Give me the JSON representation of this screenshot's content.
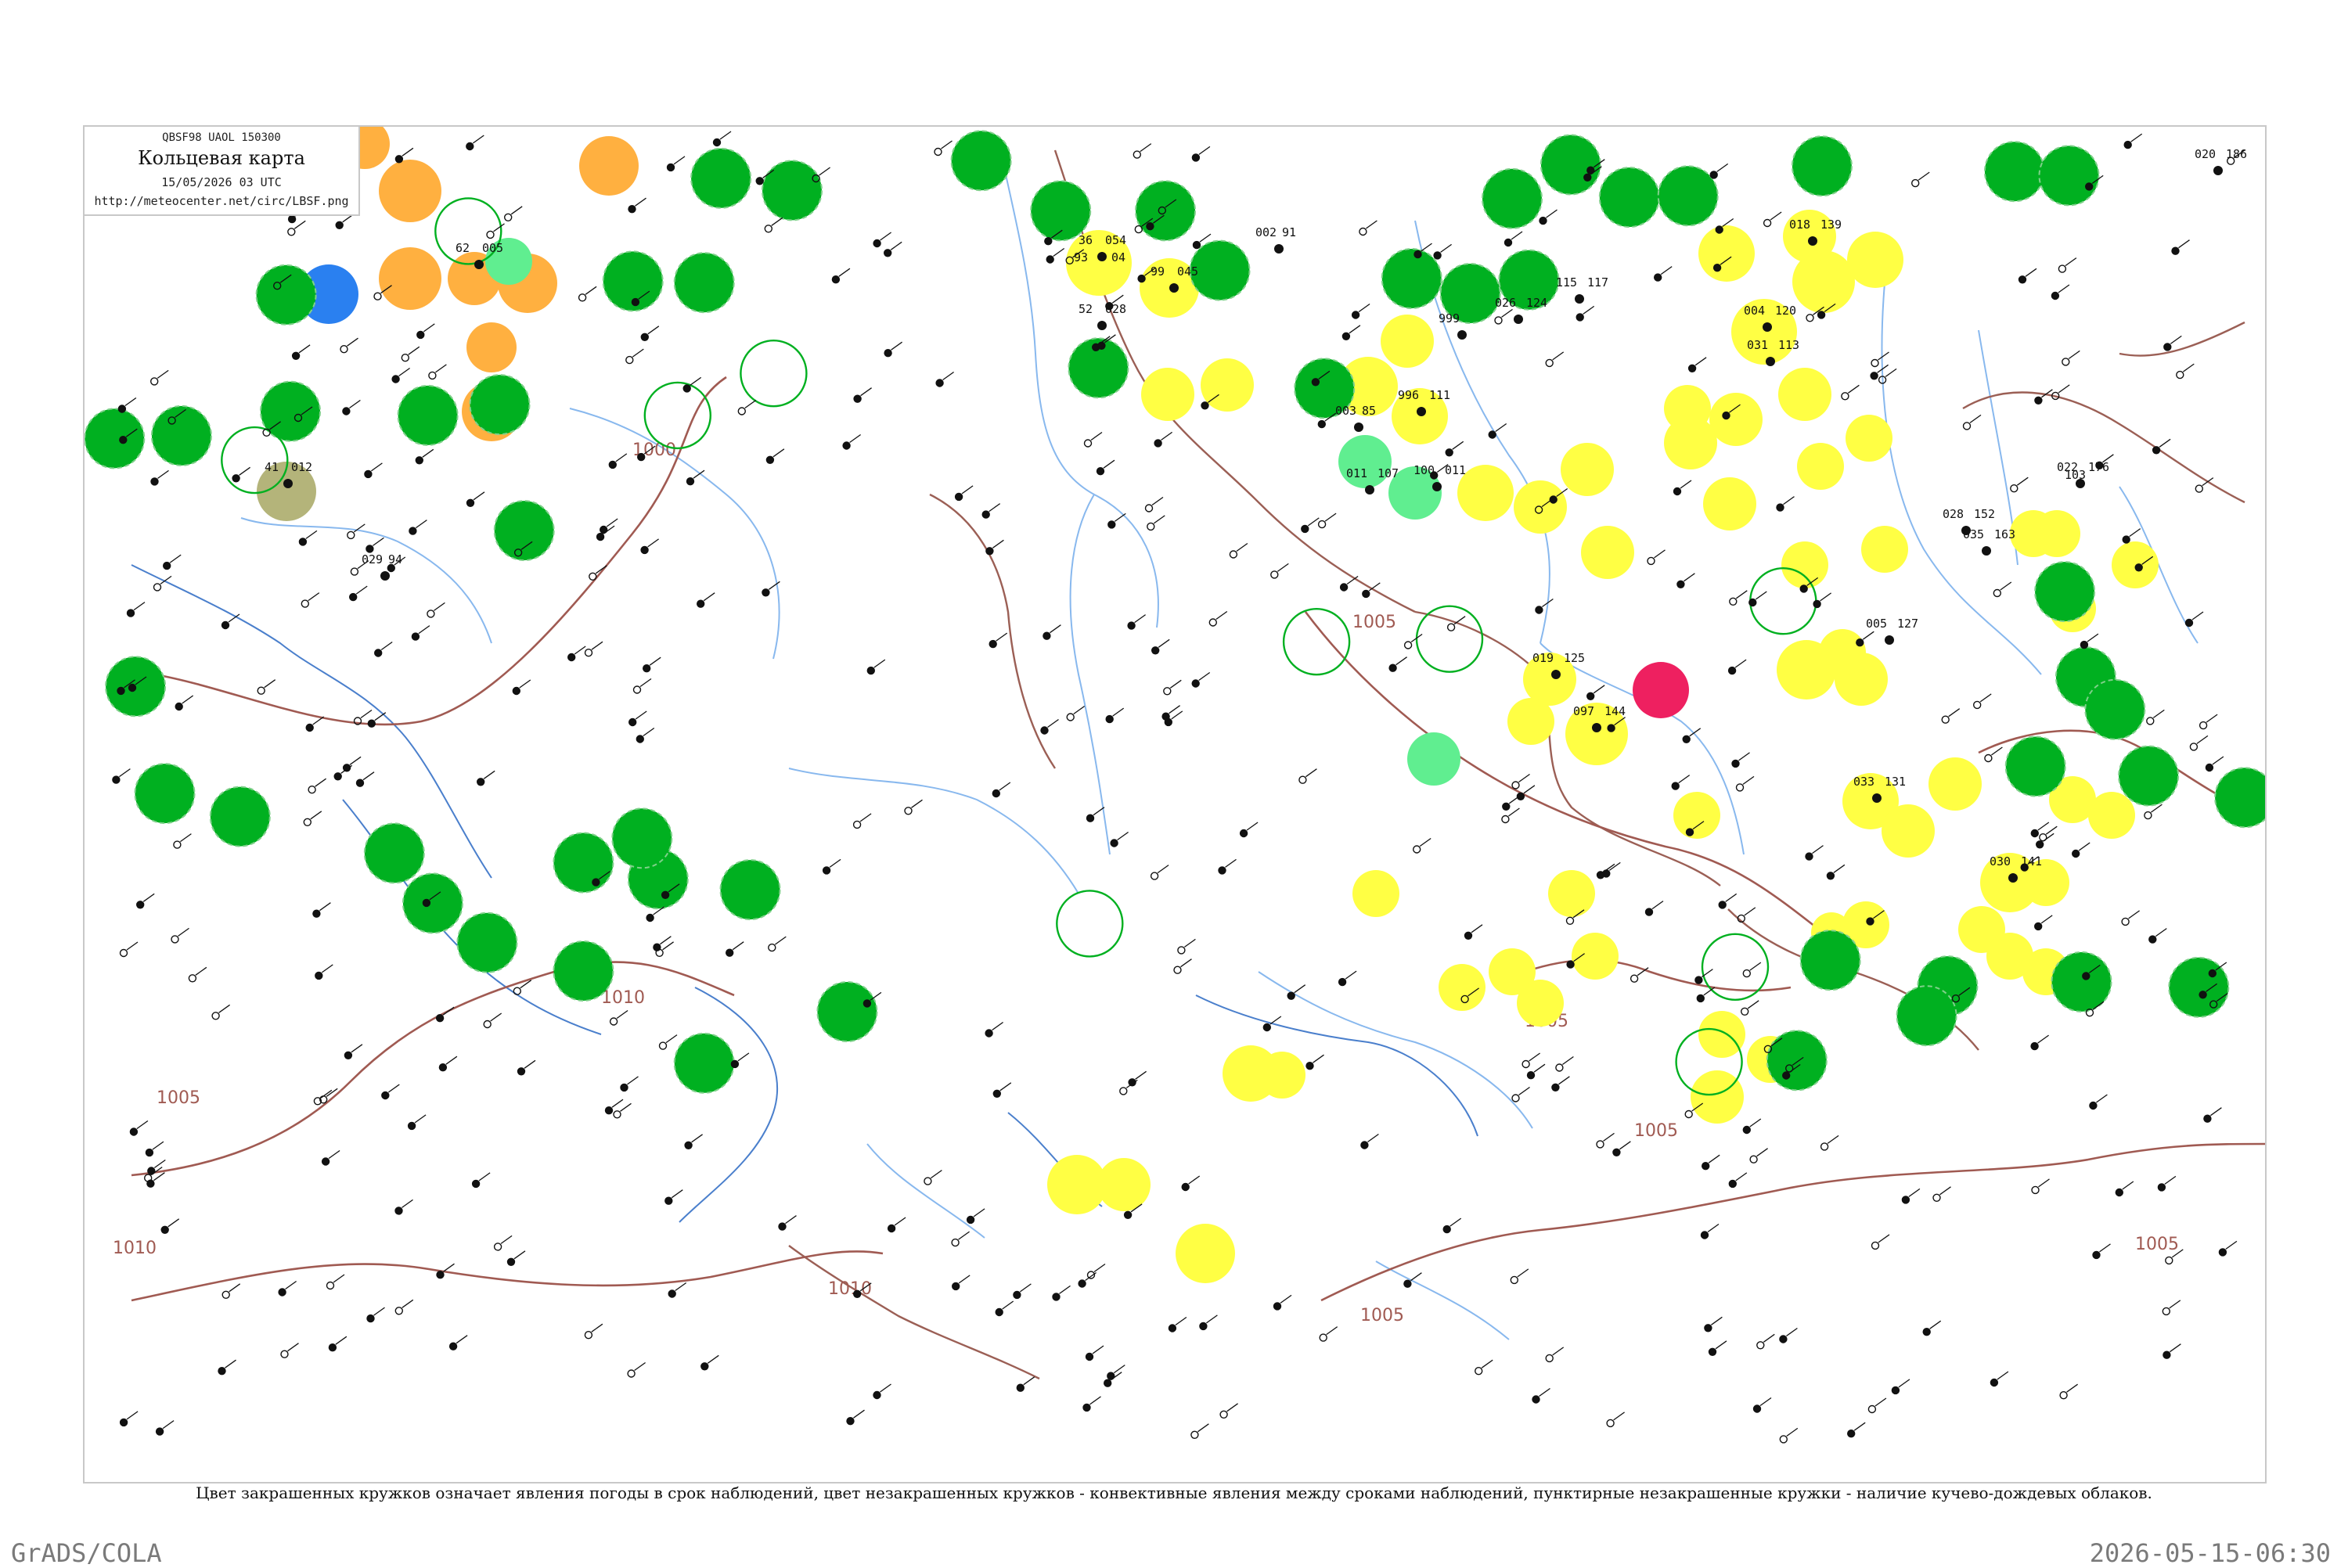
{
  "header": {
    "codes": "QBSF98  UAOL  150300",
    "title": "Кольцевая карта",
    "date": "15/05/2026 03 UTC",
    "url": "http://meteocenter.net/circ/LBSF.png"
  },
  "legend_note": "Цвет закрашенных кружков означает явления погоды в срок наблюдений, цвет незакрашенных кружков - конвективные явления между сроками наблюдений, пунктирные незакрашенные кружки - наличие кучево-дождевых облаков.",
  "footer": {
    "left": "GrADS/COLA",
    "right": "2026-05-15-06:30"
  },
  "colors": {
    "rain": "#00b020",
    "drizzle": "#ffff44",
    "snow_or_rainsnow": "#ffb040",
    "fog": "#60ee90",
    "thunderstorm_hail": "#ee2060",
    "showers_blue": "#2a80f0",
    "dust_haze": "#b4b47a",
    "isobar": "#a05a52",
    "river": "#88b8ee",
    "station_text": "#111111"
  },
  "isobars": [
    {
      "label": "1000"
    },
    {
      "label": "1005"
    },
    {
      "label": "1005"
    },
    {
      "label": "1010"
    },
    {
      "label": "1010"
    },
    {
      "label": "1010"
    },
    {
      "label": "1005"
    },
    {
      "label": "1005"
    },
    {
      "label": "1005"
    },
    {
      "label": "1005"
    }
  ],
  "station_values": [
    "36",
    "054",
    "93",
    "04",
    "52",
    "028",
    "99",
    "045",
    "002",
    "91",
    "003",
    "85",
    "011",
    "107",
    "996",
    "111",
    "004",
    "120",
    "031",
    "113",
    "030",
    "141",
    "097",
    "144",
    "019",
    "125",
    "033",
    "131",
    "029",
    "94",
    "999",
    "41",
    "012",
    "100",
    "011",
    "62",
    "005",
    "115",
    "117",
    "026",
    "124",
    "018",
    "139",
    "005",
    "127",
    "028",
    "152",
    "035",
    "163",
    "022",
    "176",
    "020",
    "186",
    "103"
  ],
  "filled_circles": [
    {
      "color": "rain",
      "lx": 0.148,
      "ly": 0.115
    },
    {
      "color": "rain",
      "lx": 0.131,
      "ly": 0.114
    },
    {
      "color": "rain",
      "lx": 0.169,
      "ly": 0.047
    },
    {
      "color": "rain",
      "lx": 0.152,
      "ly": 0.038
    },
    {
      "color": "rain",
      "lx": 0.082,
      "ly": 0.213
    },
    {
      "color": "rain",
      "lx": 0.105,
      "ly": 0.298
    },
    {
      "color": "rain",
      "lx": 0.074,
      "ly": 0.536
    },
    {
      "color": "rain",
      "lx": 0.137,
      "ly": 0.555
    },
    {
      "color": "rain",
      "lx": 0.159,
      "ly": 0.563
    },
    {
      "color": "rain",
      "lx": 0.148,
      "ly": 0.691
    },
    {
      "color": "rain",
      "lx": 0.355,
      "ly": 0.028
    },
    {
      "color": "rain",
      "lx": 0.341,
      "ly": 0.053
    },
    {
      "color": "rain",
      "lx": 0.369,
      "ly": 0.052
    },
    {
      "color": "rain",
      "lx": 0.383,
      "ly": 0.051
    },
    {
      "color": "rain",
      "lx": 0.345,
      "ly": 0.113
    },
    {
      "color": "rain",
      "lx": 0.317,
      "ly": 0.112
    },
    {
      "color": "rain",
      "lx": 0.331,
      "ly": 0.123
    },
    {
      "color": "rain",
      "lx": 0.415,
      "ly": 0.029
    },
    {
      "color": "rain",
      "lx": 0.461,
      "ly": 0.033
    },
    {
      "color": "rain",
      "lx": 0.474,
      "ly": 0.036
    },
    {
      "color": "rain",
      "lx": 0.417,
      "ly": 0.615
    },
    {
      "color": "rain",
      "lx": 0.445,
      "ly": 0.634
    },
    {
      "color": "rain",
      "lx": 0.44,
      "ly": 0.656
    },
    {
      "color": "rain",
      "lx": 0.409,
      "ly": 0.689
    },
    {
      "color": "rain",
      "lx": 0.477,
      "ly": 0.631
    },
    {
      "color": "rain",
      "lx": 0.505,
      "ly": 0.635
    },
    {
      "color": "rain",
      "lx": 0.473,
      "ly": 0.343
    },
    {
      "color": "rain",
      "lx": 0.478,
      "ly": 0.406
    },
    {
      "color": "rain",
      "lx": 0.485,
      "ly": 0.43
    },
    {
      "color": "rain",
      "lx": 0.466,
      "ly": 0.472
    },
    {
      "color": "rain",
      "lx": 0.493,
      "ly": 0.479
    },
    {
      "color": "rain",
      "lx": 0.516,
      "ly": 0.495
    },
    {
      "color": "rain",
      "lx": 0.54,
      "ly": 0.492
    },
    {
      "color": "rain",
      "lx": 0.533,
      "ly": 0.413
    },
    {
      "color": "rain",
      "lx": 0.558,
      "ly": 0.509
    },
    {
      "color": "rain",
      "lx": 0.569,
      "ly": 0.124
    },
    {
      "color": "rain",
      "lx": 0.57,
      "ly": 0.21
    },
    {
      "color": "rain",
      "lx": 0.544,
      "ly": 0.228
    },
    {
      "color": "rain",
      "lx": 0.528,
      "ly": 0.23
    },
    {
      "color": "rain",
      "lx": 0.62,
      "ly": 0.205
    },
    {
      "color": "rain",
      "lx": 0.604,
      "ly": 0.573
    },
    {
      "color": "rain",
      "lx": 0.617,
      "ly": 0.602
    },
    {
      "color": "rain",
      "lx": 0.64,
      "ly": 0.623
    },
    {
      "color": "rain",
      "lx": 0.64,
      "ly": 0.543
    },
    {
      "color": "rain",
      "lx": 0.654,
      "ly": 0.525
    },
    {
      "color": "rain",
      "lx": 0.703,
      "ly": 0.653
    },
    {
      "color": "rain",
      "lx": 0.735,
      "ly": 0.025
    },
    {
      "color": "rain",
      "lx": 0.763,
      "ly": 0.178
    },
    {
      "color": "rain",
      "lx": 0.817,
      "ly": 0.193
    },
    {
      "color": "rain",
      "lx": 0.792,
      "ly": 0.106
    },
    {
      "color": "rain",
      "lx": 0.754,
      "ly": 0.062
    },
    {
      "color": "rain",
      "lx": 0.779,
      "ly": 0.062
    }
  ],
  "open_circles": [
    {
      "lx": 0.176,
      "ly": 0.077
    },
    {
      "lx": 0.078,
      "ly": 0.246
    },
    {
      "lx": 0.316,
      "ly": 0.182
    },
    {
      "lx": 0.272,
      "ly": 0.213
    },
    {
      "lx": 0.461,
      "ly": 0.588
    },
    {
      "lx": 0.565,
      "ly": 0.38
    },
    {
      "lx": 0.626,
      "ly": 0.378
    },
    {
      "lx": 0.779,
      "ly": 0.35
    },
    {
      "lx": 0.757,
      "ly": 0.62
    },
    {
      "lx": 0.745,
      "ly": 0.69
    }
  ]
}
